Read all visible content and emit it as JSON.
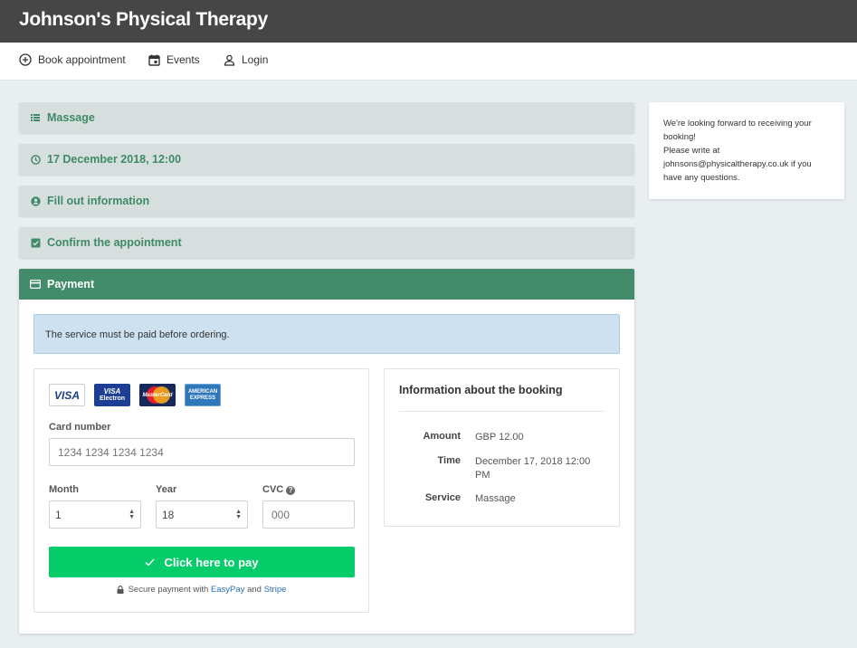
{
  "header": {
    "title": "Johnson's Physical Therapy"
  },
  "nav": [
    {
      "label": "Book appointment",
      "icon": "plus-circle-icon"
    },
    {
      "label": "Events",
      "icon": "calendar-icon"
    },
    {
      "label": "Login",
      "icon": "user-icon"
    }
  ],
  "steps": [
    {
      "label": "Massage",
      "icon": "list-icon"
    },
    {
      "label": "17 December 2018, 12:00",
      "icon": "clock-icon"
    },
    {
      "label": "Fill out information",
      "icon": "user-circle-icon"
    },
    {
      "label": "Confirm the appointment",
      "icon": "check-square-icon"
    }
  ],
  "payment": {
    "title": "Payment",
    "notice": "The service must be paid before ordering.",
    "card_logos": {
      "visa": "VISA",
      "electron_top": "VISA",
      "electron_bottom": "Electron",
      "mastercard": "MasterCard",
      "amex_top": "AMERICAN",
      "amex_bottom": "EXPRESS"
    },
    "card_number_label": "Card number",
    "card_number_placeholder": "1234 1234 1234 1234",
    "month_label": "Month",
    "month_value": "1",
    "year_label": "Year",
    "year_value": "18",
    "cvc_label": "CVC",
    "cvc_help": "?",
    "cvc_placeholder": "000",
    "pay_button": "Click here to pay",
    "secure_prefix": "Secure payment with",
    "secure_easypay": "EasyPay",
    "secure_and": "and",
    "secure_stripe": "Stripe"
  },
  "booking_info": {
    "title": "Information about the booking",
    "rows": [
      {
        "key": "Amount",
        "value": "GBP 12.00"
      },
      {
        "key": "Time",
        "value": "December 17, 2018 12:00 PM"
      },
      {
        "key": "Service",
        "value": "Massage"
      }
    ]
  },
  "sidebar": {
    "line1": "We're looking forward to receiving your booking!",
    "line2": "Please write at johnsons@physicaltherapy.co.uk if you have any questions."
  },
  "colors": {
    "header_bg": "#464646",
    "accent_green": "#428c6c",
    "pay_button": "#07cc6a",
    "notice_bg": "#cde1f1",
    "link": "#2a6fb4"
  }
}
